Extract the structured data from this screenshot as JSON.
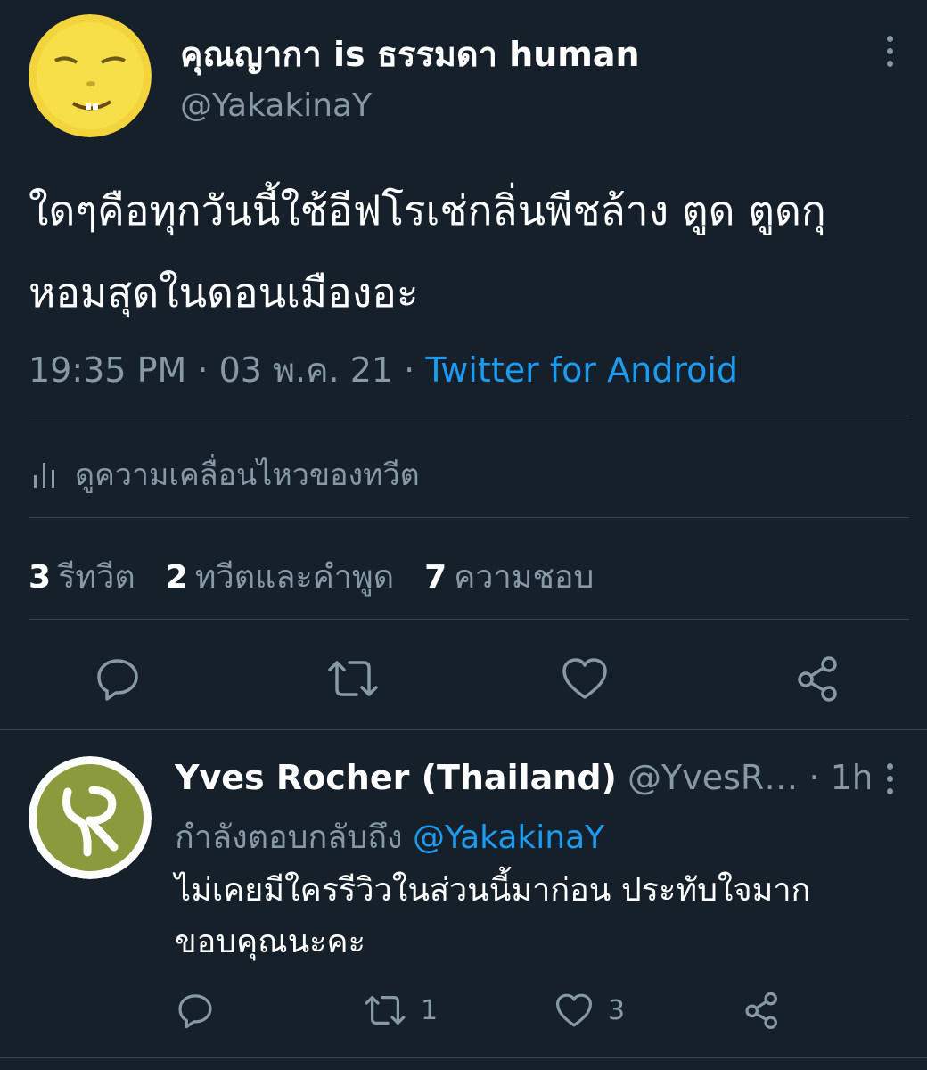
{
  "main_tweet": {
    "display_name": "คุณญากา is ธรรมดา human",
    "handle": "@YakakinaY",
    "text": "ใดๆคือทุกวันนี้ใช้อีฟโรเช่กลิ่นพีชล้าง ตูด ตูดกุหอมสุดในดอนเมืองอะ",
    "time": "19:35 PM",
    "date": "03 พ.ค. 21",
    "source": "Twitter for Android",
    "separator": "·",
    "activity_label": "ดูความเคลื่อนไหวของทวีต",
    "stats": {
      "retweets": {
        "count": "3",
        "label": "รีทวีต"
      },
      "quotes": {
        "count": "2",
        "label": "ทวีตและคำพูด"
      },
      "likes": {
        "count": "7",
        "label": "ความชอบ"
      }
    },
    "avatar_color": "#f4d43c"
  },
  "reply": {
    "display_name": "Yves Rocher (Thailand)",
    "handle": "@YvesR…",
    "time_ago": "1h",
    "separator": "·",
    "replying_to_label": "กำลังตอบกลับถึง",
    "replying_to_handle": "@YakakinaY",
    "text": "ไม่เคยมีใครรีวิวในส่วนนี้มาก่อน ประทับใจมาก ขอบคุณนะคะ",
    "retweet_count": "1",
    "like_count": "3",
    "avatar_color": "#8a9a3c"
  },
  "colors": {
    "background": "#15202b",
    "secondary_text": "#8899a6",
    "link": "#1d9bf0",
    "divider": "#38444d"
  }
}
